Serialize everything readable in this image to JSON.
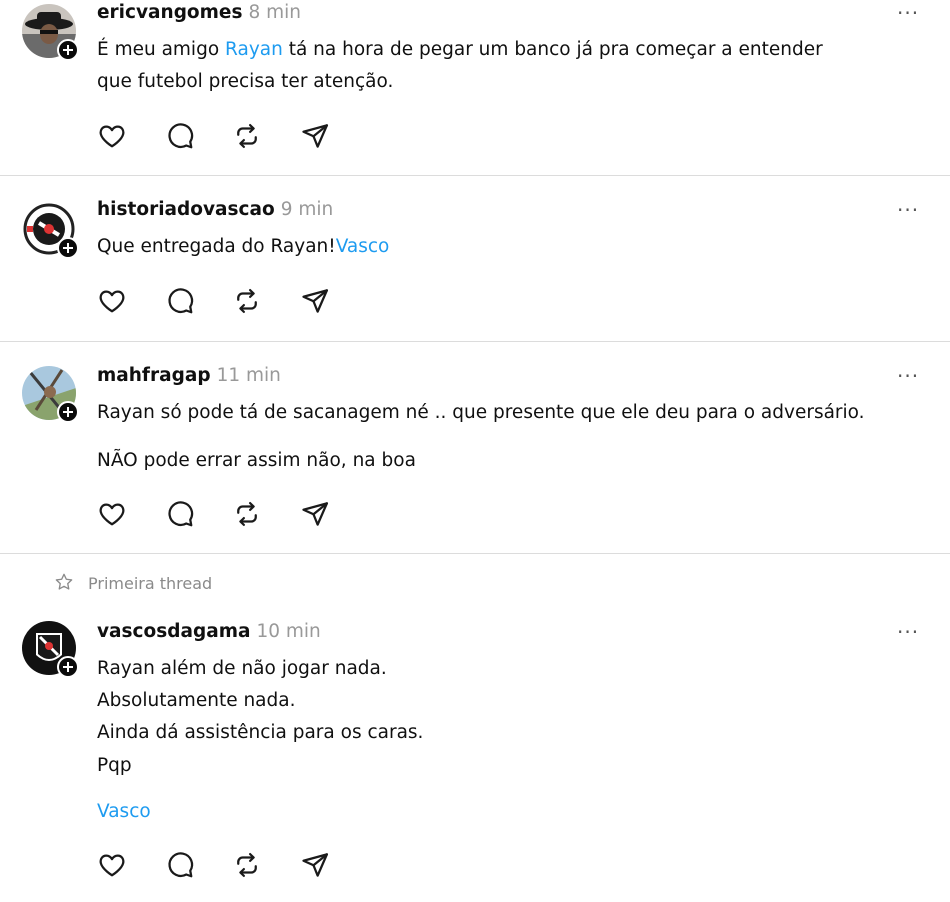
{
  "posts": [
    {
      "username": "ericvangomes",
      "time": "8 min",
      "more": "···",
      "text_before": "É meu amigo ",
      "mention": "Rayan",
      "text_after": " tá na hora de pegar um banco já pra começar a entender",
      "line2": "que futebol precisa ter atenção."
    },
    {
      "username": "historiadovascao",
      "time": "9 min",
      "more": "···",
      "text": "Que entregada do Rayan!",
      "tag": "Vasco"
    },
    {
      "username": "mahfragap",
      "time": "11 min",
      "more": "···",
      "para1": "Rayan só pode tá de sacanagem né .. que presente que ele deu para o adversário.",
      "para2": "NÃO pode errar assim não, na boa"
    },
    {
      "pinned_label": "Primeira thread",
      "username": "vascosdagama",
      "time": "10 min",
      "more": "···",
      "lines": [
        "Rayan além de não jogar nada.",
        "Absolutamente nada.",
        "Ainda dá assistência para os caras.",
        "Pqp"
      ],
      "tag": "Vasco"
    }
  ],
  "icons": {
    "like": "heart-icon",
    "reply": "comment-icon",
    "repost": "repost-icon",
    "share": "send-icon",
    "pinned": "star-icon",
    "more": "more-options-icon",
    "follow": "plus-icon"
  },
  "colors": {
    "link": "#1d9bf0",
    "muted": "#999999",
    "divider": "#dcdcdc"
  }
}
